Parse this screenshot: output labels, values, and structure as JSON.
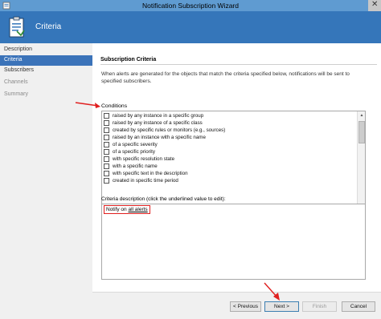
{
  "window": {
    "title": "Notification Subscription Wizard",
    "close_glyph": "✕"
  },
  "header": {
    "title": "Criteria",
    "icon": "wizard-clipboard-icon"
  },
  "sidebar": {
    "items": [
      {
        "label": "Description",
        "state": "normal"
      },
      {
        "label": "Criteria",
        "state": "active"
      },
      {
        "label": "Subscribers",
        "state": "normal"
      },
      {
        "label": "Channels",
        "state": "disabled"
      },
      {
        "label": "Summary",
        "state": "disabled"
      }
    ]
  },
  "main": {
    "section_title": "Subscription Criteria",
    "intro": "When alerts are generated for the objects that match the criteria specified below, notifications will be sent to specified subscribers.",
    "conditions_label": "Conditions",
    "conditions": [
      "raised by any instance in a specific group",
      "raised by any instance of a specific class",
      "created by specific rules or monitors (e.g., sources)",
      "raised by an instance with a specific name",
      "of a specific severity",
      "of a specific priority",
      "with specific resolution state",
      "with a specific name",
      "with specific text in the description",
      "created in specific time period"
    ],
    "description_label": "Criteria description (click the underlined value to edit):",
    "description_prefix": "Notify on ",
    "description_link": "all alerts"
  },
  "footer": {
    "previous_label": "< Previous",
    "next_label": "Next >",
    "finish_label": "Finish",
    "cancel_label": "Cancel"
  },
  "colors": {
    "header_blue": "#3576ba",
    "selected_nav": "#3b73b9",
    "annotation_red": "#e01f1f"
  }
}
